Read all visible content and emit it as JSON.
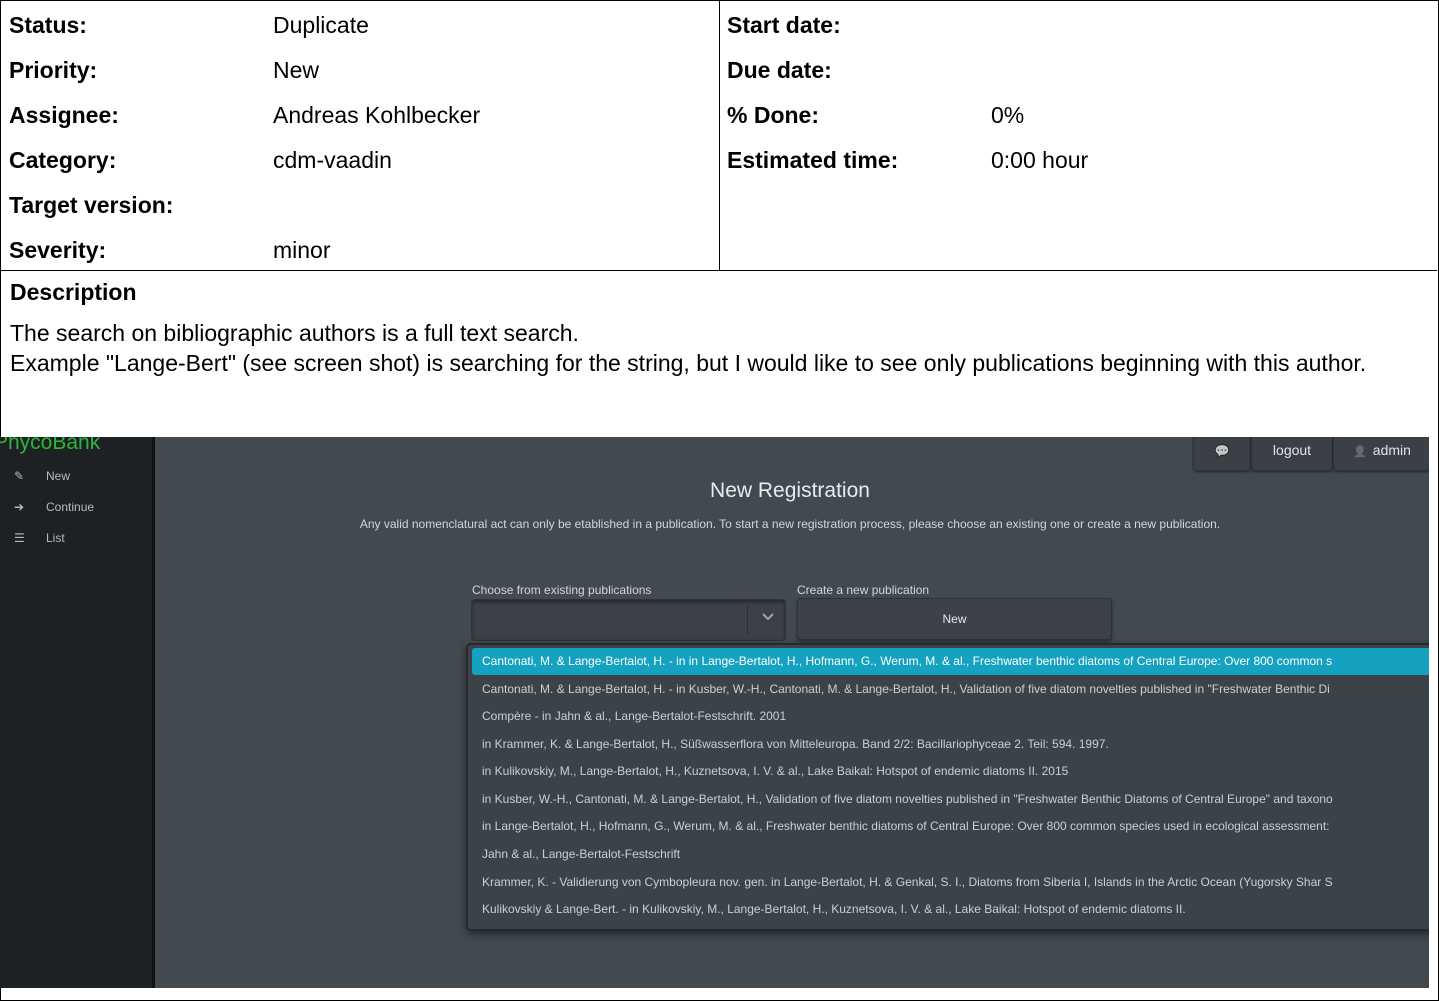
{
  "attributes": {
    "left": [
      {
        "label": "Status:",
        "value": "Duplicate"
      },
      {
        "label": "Priority:",
        "value": "New"
      },
      {
        "label": "Assignee:",
        "value": "Andreas Kohlbecker"
      },
      {
        "label": "Category:",
        "value": "cdm-vaadin"
      },
      {
        "label": "Target version:",
        "value": ""
      },
      {
        "label": "Severity:",
        "value": "minor"
      }
    ],
    "right": [
      {
        "label": "Start date:",
        "value": ""
      },
      {
        "label": "Due date:",
        "value": ""
      },
      {
        "label": "% Done:",
        "value": "0%"
      },
      {
        "label": "Estimated time:",
        "value": "0:00 hour"
      }
    ]
  },
  "description": {
    "title": "Description",
    "line1": "The search on bibliographic authors is a full text search.",
    "line2": "Example \"Lange-Bert\" (see screen shot) is searching for the string, but I would like to see only publications beginning with this author."
  },
  "screenshot": {
    "brand": "PhycoBank",
    "sidebar": [
      {
        "icon": "✎",
        "label": "New"
      },
      {
        "icon": "➔",
        "label": "Continue"
      },
      {
        "icon": "☰",
        "label": "List"
      }
    ],
    "topbar": {
      "chat_icon": "💬",
      "logout": "logout",
      "admin_icon": "👤",
      "admin": "admin"
    },
    "title": "New Registration",
    "subtitle": "Any valid nomenclatural act can only be etablished in a publication. To start a new registration process, please choose an existing one or create a new publication.",
    "choose_label": "Choose from existing publications",
    "create_label": "Create a new publication",
    "new_button": "New",
    "dropdown_items": [
      "Cantonati, M. & Lange-Bertalot, H. - in in Lange-Bertalot, H., Hofmann, G., Werum, M. & al., Freshwater benthic diatoms of Central Europe: Over 800 common s",
      "Cantonati, M. & Lange-Bertalot, H. - in Kusber, W.-H., Cantonati, M. & Lange-Bertalot, H., Validation of five diatom novelties published in \"Freshwater Benthic Di",
      "Compère - in Jahn & al., Lange-Bertalot-Festschrift. 2001",
      "in Krammer, K. & Lange-Bertalot, H., Süßwasserflora von Mitteleuropa. Band 2/2: Bacillariophyceae 2. Teil: 594. 1997.",
      "in Kulikovskiy, M., Lange-Bertalot, H., Kuznetsova, I. V. & al., Lake Baikal: Hotspot of endemic diatoms II. 2015",
      "in Kusber, W.-H., Cantonati, M. & Lange-Bertalot, H., Validation of five diatom novelties published in \"Freshwater Benthic Diatoms of Central Europe\" and taxono",
      "in Lange-Bertalot, H., Hofmann, G., Werum, M. & al., Freshwater benthic diatoms of Central Europe: Over 800 common species used in ecological assessment:",
      "Jahn & al., Lange-Bertalot-Festschrift",
      "Krammer, K. - Validierung von Cymbopleura nov. gen. in Lange-Bertalot, H. & Genkal, S. I., Diatoms from Siberia I, Islands in the Arctic Ocean (Yugorsky Shar S",
      "Kulikovskiy & Lange-Bert. - in Kulikovskiy, M., Lange-Bertalot, H., Kuznetsova, I. V. & al., Lake Baikal: Hotspot of endemic diatoms II."
    ]
  }
}
